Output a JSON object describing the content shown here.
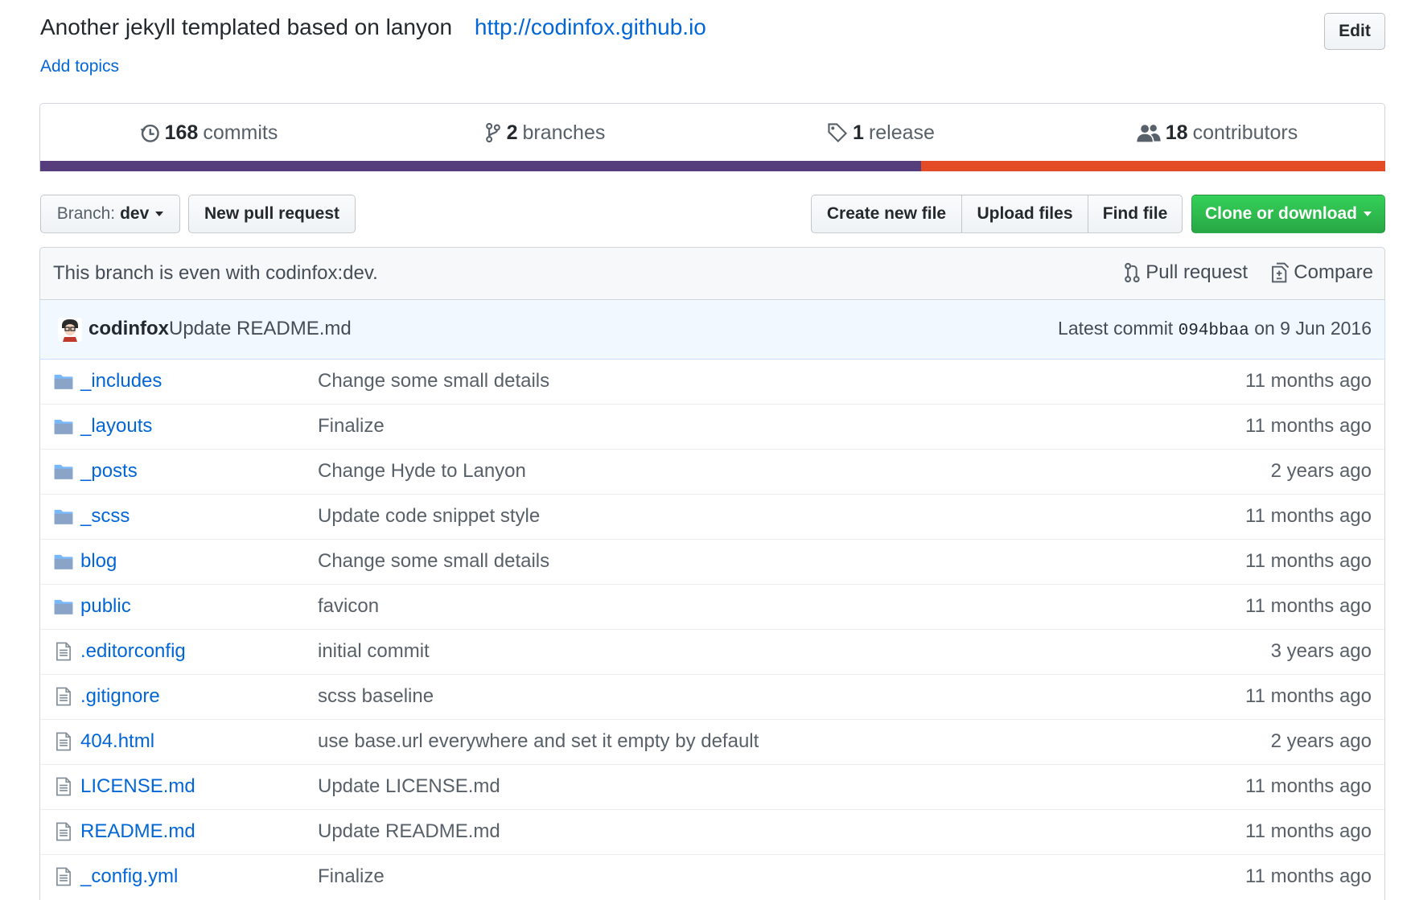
{
  "repo": {
    "description": "Another jekyll templated based on lanyon",
    "homepage": "http://codinfox.github.io",
    "add_topics": "Add topics",
    "edit_label": "Edit"
  },
  "summary": {
    "commits": {
      "count": "168",
      "label": "commits",
      "icon": "history-icon"
    },
    "branches": {
      "count": "2",
      "label": "branches",
      "icon": "git-branch-icon"
    },
    "releases": {
      "count": "1",
      "label": "release",
      "icon": "tag-icon"
    },
    "contributors": {
      "count": "18",
      "label": "contributors",
      "icon": "people-icon"
    }
  },
  "languages": [
    {
      "color": "#563d7c",
      "fraction": 0.655
    },
    {
      "color": "#e34c26",
      "fraction": 0.345
    }
  ],
  "toolbar": {
    "branch_prefix": "Branch:",
    "branch_name": "dev",
    "new_pull_request": "New pull request",
    "create_new_file": "Create new file",
    "upload_files": "Upload files",
    "find_file": "Find file",
    "clone_or_download": "Clone or download"
  },
  "branch_info": {
    "status": "This branch is even with codinfox:dev.",
    "pull_request": "Pull request",
    "compare": "Compare"
  },
  "latest_commit": {
    "author": "codinfox",
    "message": "Update README.md",
    "prefix": "Latest commit",
    "sha": "094bbaa",
    "date": "on 9 Jun 2016"
  },
  "files": [
    {
      "type": "dir",
      "name": "_includes",
      "message": "Change some small details",
      "age": "11 months ago"
    },
    {
      "type": "dir",
      "name": "_layouts",
      "message": "Finalize",
      "age": "11 months ago"
    },
    {
      "type": "dir",
      "name": "_posts",
      "message": "Change Hyde to Lanyon",
      "age": "2 years ago"
    },
    {
      "type": "dir",
      "name": "_scss",
      "message": "Update code snippet style",
      "age": "11 months ago"
    },
    {
      "type": "dir",
      "name": "blog",
      "message": "Change some small details",
      "age": "11 months ago"
    },
    {
      "type": "dir",
      "name": "public",
      "message": "favicon",
      "age": "11 months ago"
    },
    {
      "type": "file",
      "name": ".editorconfig",
      "message": "initial commit",
      "age": "3 years ago"
    },
    {
      "type": "file",
      "name": ".gitignore",
      "message": "scss baseline",
      "age": "11 months ago"
    },
    {
      "type": "file",
      "name": "404.html",
      "message": "use base.url everywhere and set it empty by default",
      "age": "2 years ago"
    },
    {
      "type": "file",
      "name": "LICENSE.md",
      "message": "Update LICENSE.md",
      "age": "11 months ago"
    },
    {
      "type": "file",
      "name": "README.md",
      "message": "Update README.md",
      "age": "11 months ago"
    },
    {
      "type": "file",
      "name": "_config.yml",
      "message": "Finalize",
      "age": "11 months ago"
    }
  ]
}
